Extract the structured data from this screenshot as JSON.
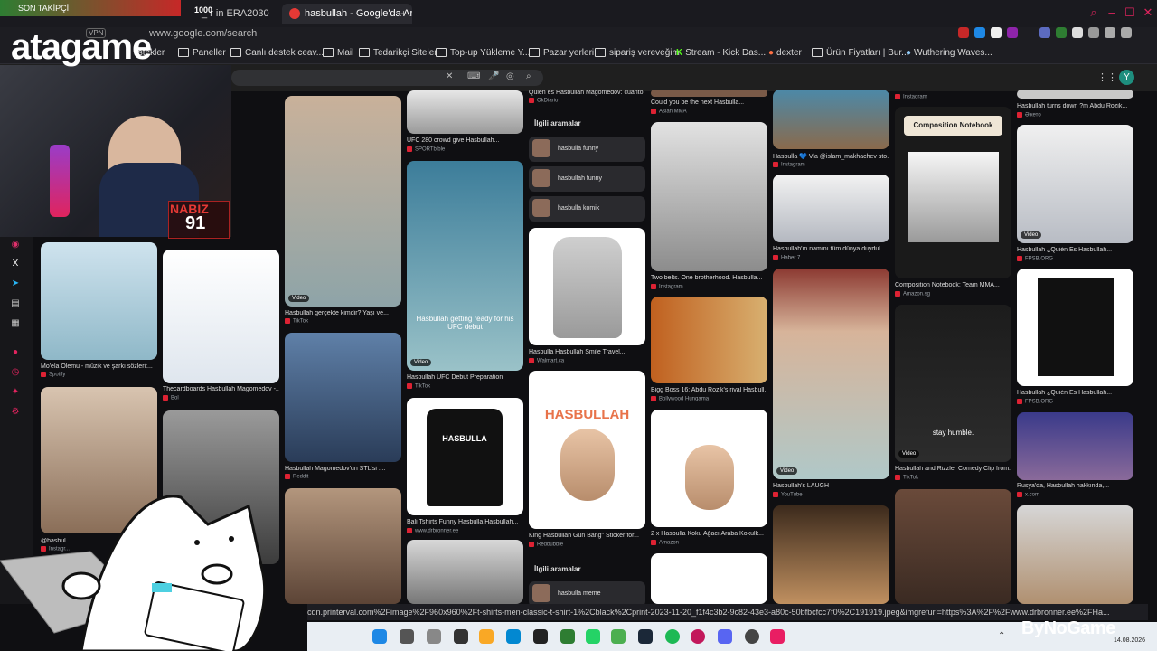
{
  "stream": {
    "brand": "atagame",
    "follow_label": "SON TAKİPÇİ",
    "follow_count": "1000",
    "pulse_label": "NABIZ",
    "pulse_value": "91",
    "sponsor": "ByNoGame",
    "date": "14.08.2026"
  },
  "browser": {
    "tabs": [
      {
        "label": "_ r in ERA2030",
        "active": false
      },
      {
        "label": "hasbullah - Google'da Ara",
        "active": true
      }
    ],
    "new_tab": "+",
    "url": "www.google.com/search",
    "vpn": "VPN",
    "bookmarks": [
      "İstekler",
      "Paneller",
      "Canlı destek ceav...",
      "Mail",
      "Tedarikçi Siteler",
      "Top-up Yükleme Y...",
      "Pazar yerleri",
      "sipariş vereveğim",
      "Stream - Kick Das...",
      "dexter",
      "Ürün Fiyatları | Bur...",
      "Wuthering Waves..."
    ],
    "status_url": "cdn.printerval.com%2Fimage%2F960x960%2Ft-shirts-men-classic-t-shirt-1%2Cblack%2Cprint-2023-11-20_f1f4c3b2-9c82-43e3-a80c-50bfbcfcc7f0%2C191919.jpeg&imgrefurl=https%3A%2F%2Fwww.drbronner.ee%2FHa..."
  },
  "search": {
    "close": "✕",
    "profile_initial": "Y"
  },
  "results": [
    {
      "caption": "Mo'ela Olemu - müzik ve şarkı sözleri:...",
      "source": "Spotify"
    },
    {
      "caption": "Thecardboards Hasbullah Magomedov -...",
      "source": "Bol"
    },
    {
      "caption": "@hasbul...",
      "source": "Instagr..."
    },
    {
      "caption": "Hasbullah gerçekte kimdir? Yaşı ve...",
      "source": "TikTok"
    },
    {
      "caption": "Hasbullah Magomedov'un STL'si :...",
      "source": "Reddit"
    },
    {
      "caption": "UFC 280 crowd give Hasbullah...",
      "source": "SPORTbible"
    },
    {
      "caption": "Hasbullah UFC Debut Preparation",
      "source": "TikTok",
      "overlay": "Hasbullah getting ready for his UFC debut"
    },
    {
      "caption": "Bali Tshirts Funny Hasbulla Hasbullah...",
      "source": "www.drbronner.ee",
      "print": "HASBULLA"
    },
    {
      "caption": "Hasbulla Hasbullah Smile Travel...",
      "source": "Walmart.ca"
    },
    {
      "caption": "King Hasbullah Gun Bang\" Sticker for...",
      "source": "Redbubble",
      "print": "HASBULLAH"
    },
    {
      "caption": "Quién es Hasbullah Magomedov: cuánto...",
      "source": "OkDiario"
    },
    {
      "caption": "Could you be the next Hasbulla...",
      "source": "Asian MMA"
    },
    {
      "caption": "Two belts. One brotherhood. Hasbulla...",
      "source": "Instagram"
    },
    {
      "caption": "Bigg Boss 16: Abdu Rozik's rival Hasbull...",
      "source": "Bollywood Hungama"
    },
    {
      "caption": "2 x Hasbulla Koku Ağacı Araba Kokulk...",
      "source": "Amazon"
    },
    {
      "caption": "Hasbulla 💙 Via @islam_makhachev sto...",
      "source": "Instagram"
    },
    {
      "caption": "Hasbullah'ın namını tüm dünya duydul...",
      "source": "Haber 7"
    },
    {
      "caption": "Hasbullah's LAUGH",
      "source": "YouTube"
    },
    {
      "caption": "Composition Notebook: Team MMA...",
      "source": "Amazon.sg",
      "print": "Composition Notebook"
    },
    {
      "caption": "Hasbullah and Rizzler Comedy Clip from...",
      "source": "TikTok",
      "overlay": "stay humble."
    },
    {
      "caption": "Hasbullah turns down ?m Abdu Rozik...",
      "source": "Əlкето"
    },
    {
      "caption": "Hasbullah ¿Quién Es Hasbullah...",
      "source": "FPSB.ORG"
    },
    {
      "caption": "Hasbullah ¿Quién Es Hasbullah...",
      "source": "FPSB.ORG"
    },
    {
      "caption": "Rusya'da, Hasbullah hakkında,...",
      "source": "x.com"
    }
  ],
  "related": {
    "heading": "İlgili aramalar",
    "items": [
      "hasbulla funny",
      "hasbullah funny",
      "hasbulla komik"
    ],
    "heading2": "İlgili aramalar",
    "items2": [
      "hasbulla meme"
    ]
  },
  "labels": {
    "video": "Video",
    "instagram_top": "Instagram"
  }
}
